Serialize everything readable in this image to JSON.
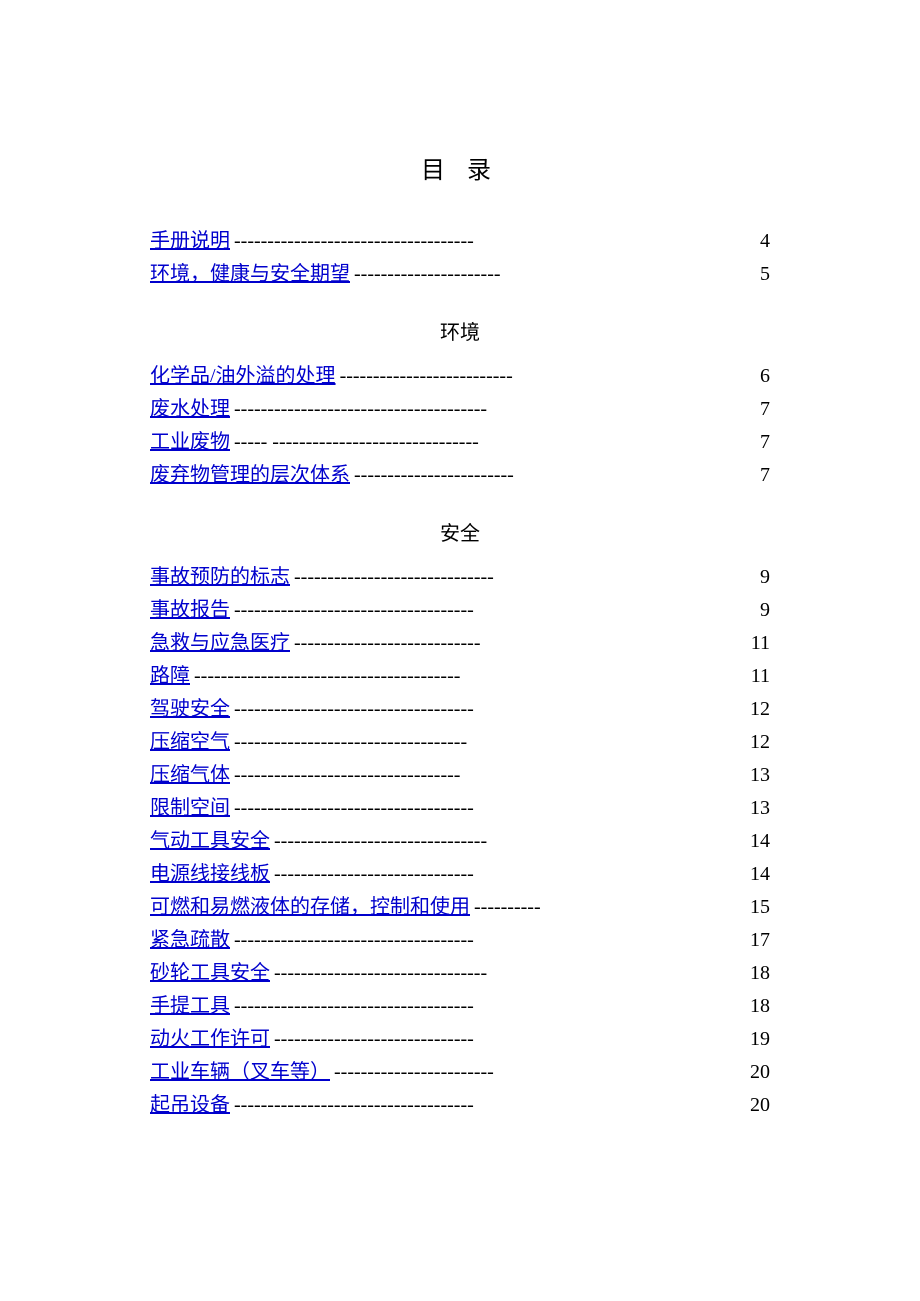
{
  "title": "目 录",
  "sections": [
    {
      "heading": null,
      "items": [
        {
          "label": "手册说明",
          "leader": " ------------------------------------",
          "page": "4"
        },
        {
          "label": "环境，健康与安全期望",
          "leader": " ----------------------",
          "page": "5"
        }
      ]
    },
    {
      "heading": "环境",
      "items": [
        {
          "label": "化学品/油外溢的处理",
          "leader": "--------------------------",
          "page": "6"
        },
        {
          "label": "废水处理",
          "leader": "--------------------------------------",
          "page": "7"
        },
        {
          "label": "工业废物",
          "leader": "----- -------------------------------",
          "page": "7"
        },
        {
          "label": "废弃物管理的层次体系",
          "leader": " ------------------------",
          "page": "7"
        }
      ]
    },
    {
      "heading": "安全",
      "items": [
        {
          "label": "事故预防的标志",
          "leader": " ------------------------------",
          "page": "9"
        },
        {
          "label": "事故报告",
          "leader": " ------------------------------------",
          "page": "9"
        },
        {
          "label": "急救与应急医疗",
          "leader": " ----------------------------",
          "page": "11"
        },
        {
          "label": "路障",
          "leader": " ----------------------------------------",
          "page": "11"
        },
        {
          "label": "驾驶安全",
          "leader": " ------------------------------------",
          "page": "12"
        },
        {
          "label": "压缩空气",
          "leader": " -----------------------------------",
          "page": "12"
        },
        {
          "label": "压缩气体",
          "leader": " ----------------------------------",
          "page": "13"
        },
        {
          "label": "限制空间",
          "leader": " ------------------------------------",
          "page": "13"
        },
        {
          "label": "气动工具安全",
          "leader": " --------------------------------",
          "page": "14"
        },
        {
          "label": "电源线接线板",
          "leader": " ------------------------------",
          "page": "14"
        },
        {
          "label": "可燃和易燃液体的存储，控制和使用",
          "leader": " ----------",
          "page": "15"
        },
        {
          "label": "紧急疏散",
          "leader": " ------------------------------------",
          "page": "17"
        },
        {
          "label": "砂轮工具安全",
          "leader": " --------------------------------",
          "page": "18"
        },
        {
          "label": "手提工具",
          "leader": " ------------------------------------",
          "page": "18"
        },
        {
          "label": "动火工作许可",
          "leader": " ------------------------------",
          "page": "19"
        },
        {
          "label": "工业车辆（叉车等）",
          "leader": " ------------------------",
          "page": "20"
        },
        {
          "label": "起吊设备",
          "leader": " ------------------------------------",
          "page": "20"
        }
      ]
    }
  ]
}
